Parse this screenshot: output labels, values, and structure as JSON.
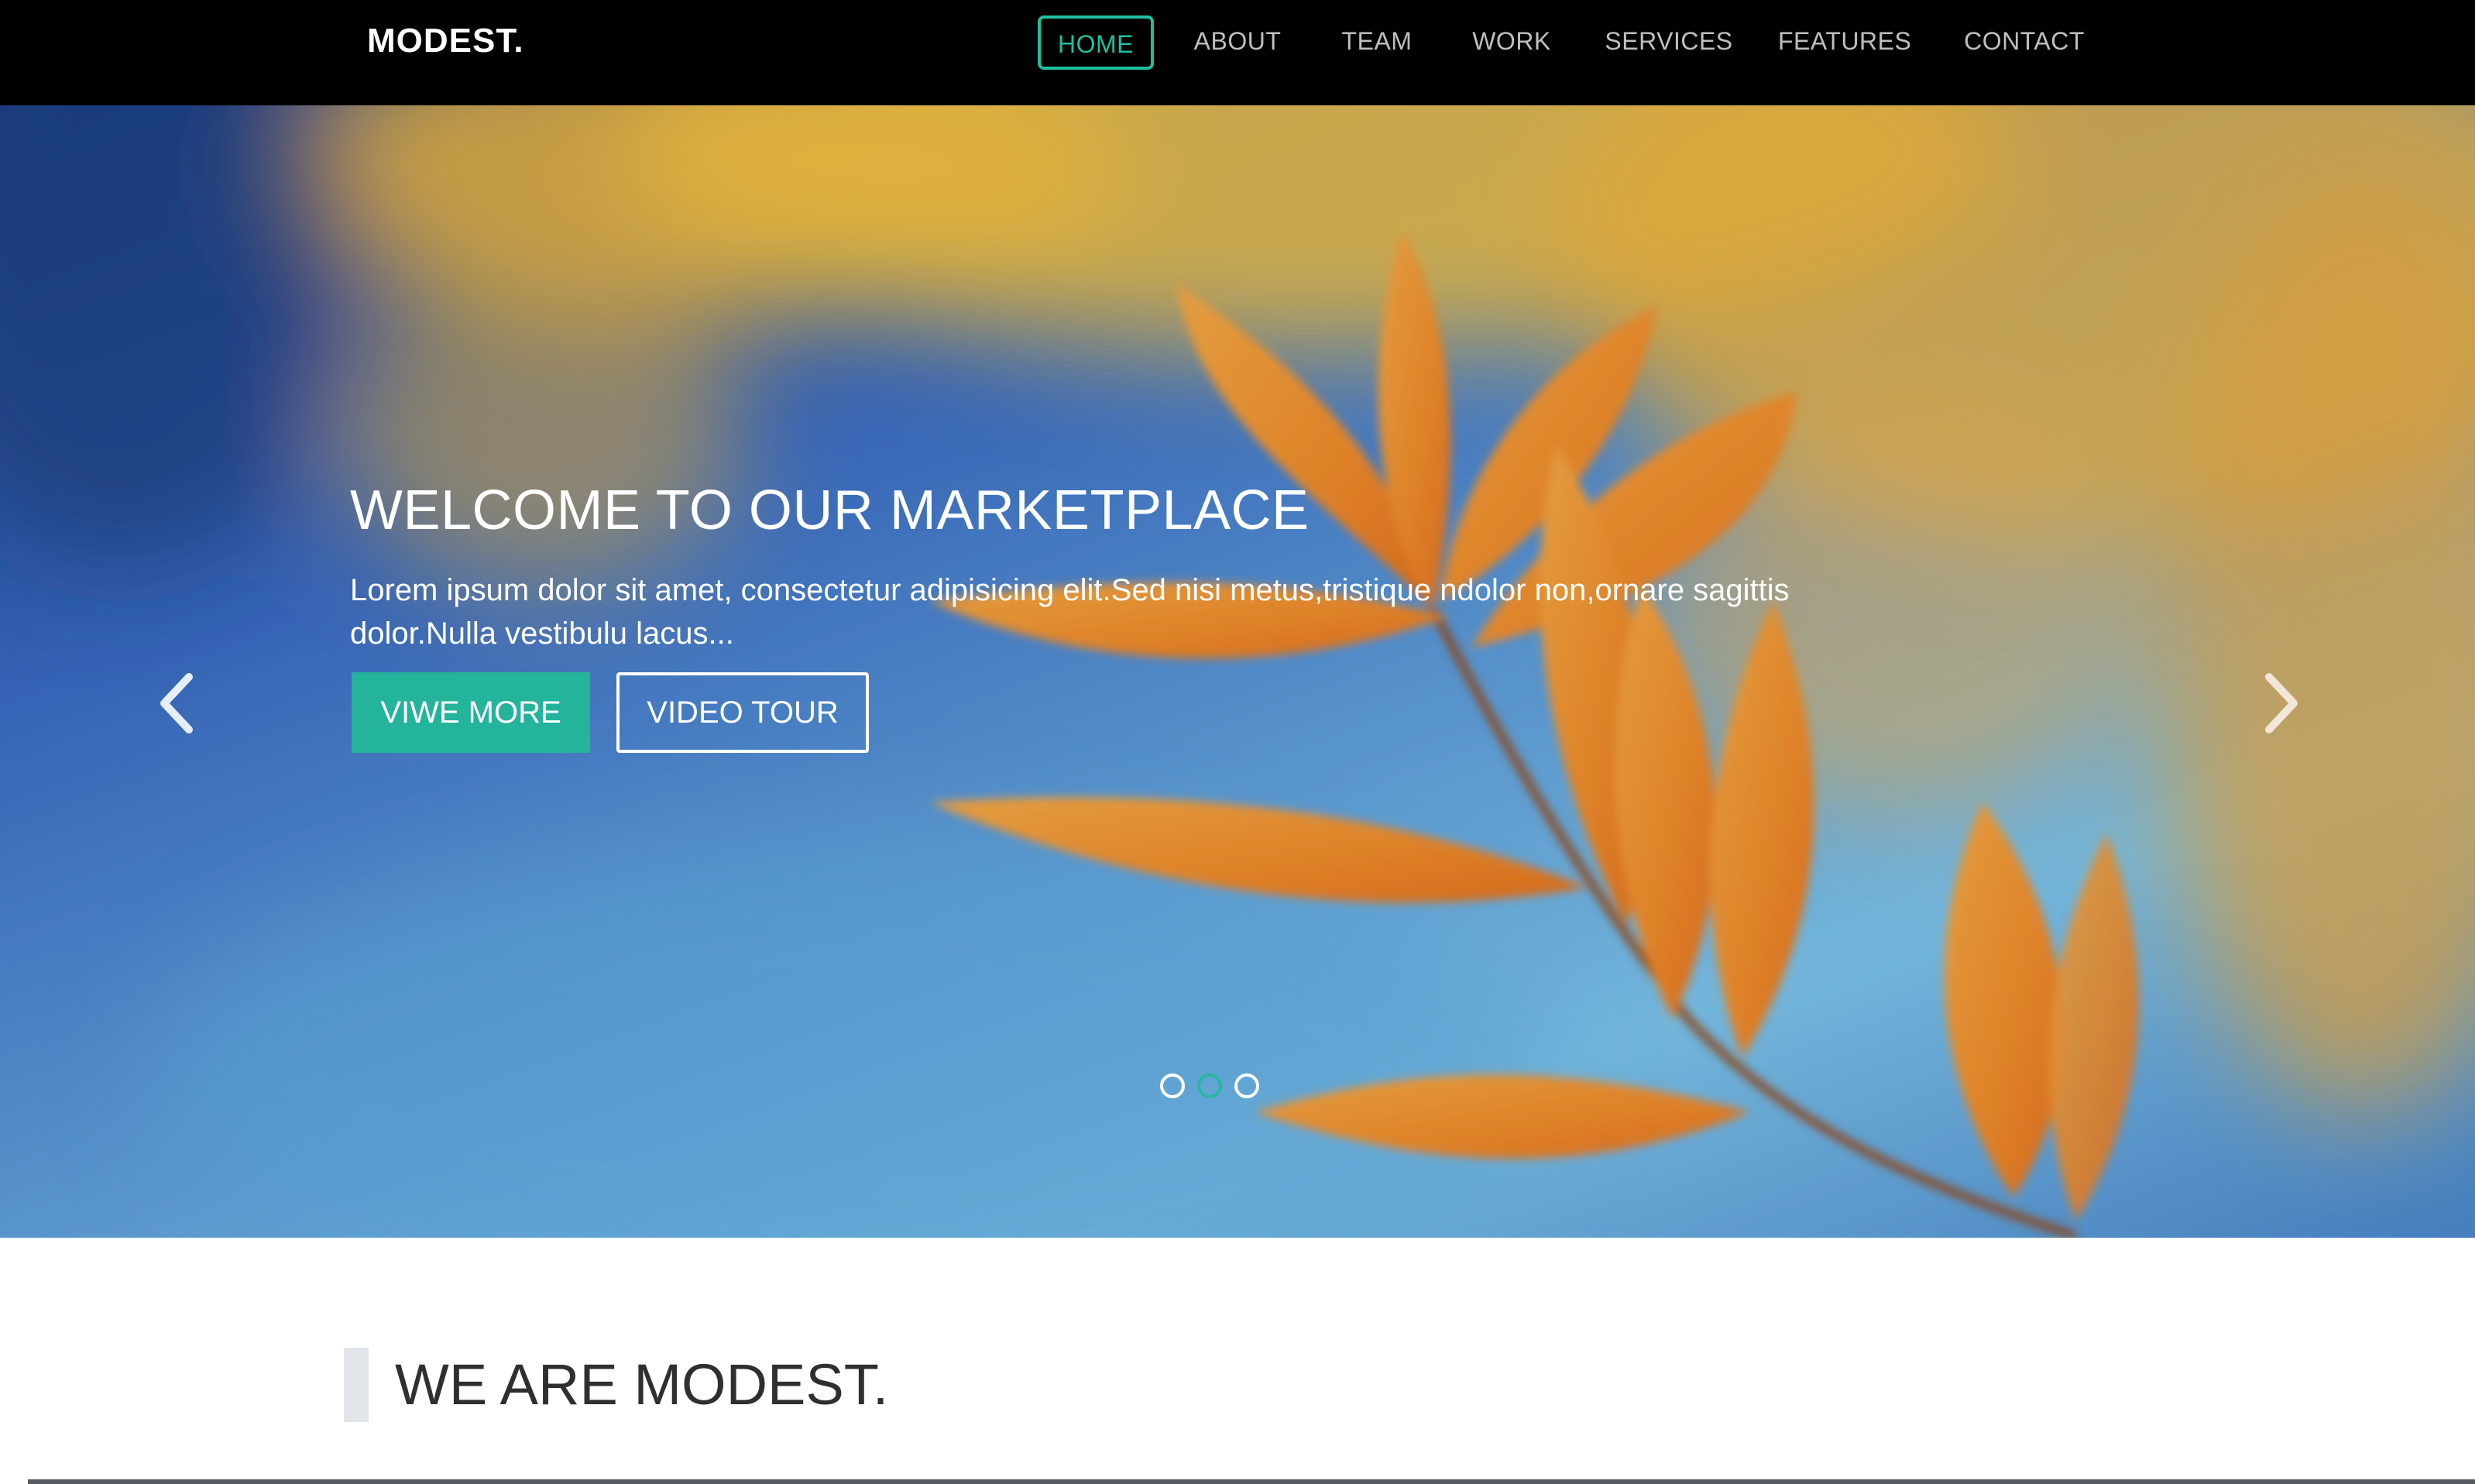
{
  "brand": {
    "logo": "MODEST."
  },
  "nav": {
    "items": [
      {
        "label": "HOME",
        "active": true
      },
      {
        "label": "ABOUT",
        "active": false
      },
      {
        "label": "TEAM",
        "active": false
      },
      {
        "label": "WORK",
        "active": false
      },
      {
        "label": "SERVICES",
        "active": false
      },
      {
        "label": "FEATURES",
        "active": false
      },
      {
        "label": "CONTACT",
        "active": false
      }
    ]
  },
  "hero": {
    "title": "WELCOME TO OUR MARKETPLACE",
    "text": "Lorem ipsum dolor sit amet, consectetur adipisicing elit.Sed nisi metus,tristique ndolor non,ornare sagittis dolor.Nulla vestibulu lacus...",
    "primary_button": "VIWE MORE",
    "secondary_button": "VIDEO TOUR",
    "prev_icon": "chevron-left-icon",
    "next_icon": "chevron-right-icon",
    "slides_total": 3,
    "active_slide": 2
  },
  "about": {
    "title": "WE ARE MODEST."
  },
  "colors": {
    "accent": "#24b39b",
    "nav_bg": "#000000",
    "nav_text": "#bfbfbf"
  }
}
